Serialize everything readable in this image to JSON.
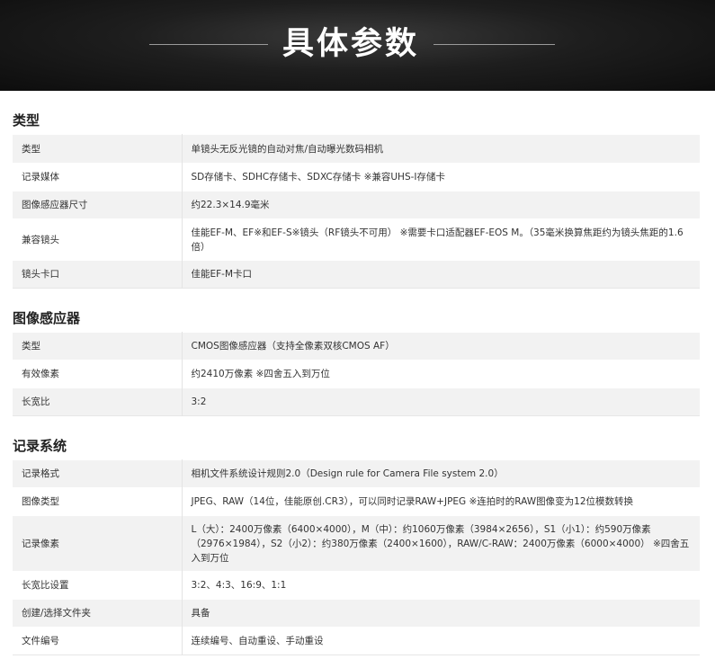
{
  "banner": {
    "title": "具体参数"
  },
  "sections": [
    {
      "title": "类型",
      "rows": [
        {
          "key": "类型",
          "value": "单镜头无反光镜的自动对焦/自动曝光数码相机"
        },
        {
          "key": "记录媒体",
          "value": "SD存储卡、SDHC存储卡、SDXC存储卡 ※兼容UHS-I存储卡"
        },
        {
          "key": "图像感应器尺寸",
          "value": "约22.3×14.9毫米"
        },
        {
          "key": "兼容镜头",
          "value": "佳能EF-M、EF※和EF-S※镜头（RF镜头不可用） ※需要卡口适配器EF-EOS M。（35毫米换算焦距约为镜头焦距的1.6倍）"
        },
        {
          "key": "镜头卡口",
          "value": "佳能EF-M卡口"
        }
      ]
    },
    {
      "title": "图像感应器",
      "rows": [
        {
          "key": "类型",
          "value": "CMOS图像感应器（支持全像素双核CMOS AF）"
        },
        {
          "key": "有效像素",
          "value": "约2410万像素 ※四舍五入到万位"
        },
        {
          "key": "长宽比",
          "value": "3:2"
        }
      ]
    },
    {
      "title": "记录系统",
      "rows": [
        {
          "key": "记录格式",
          "value": "相机文件系统设计规则2.0（Design rule for Camera File system 2.0）"
        },
        {
          "key": "图像类型",
          "value": "JPEG、RAW（14位，佳能原创.CR3），可以同时记录RAW+JPEG ※连拍时的RAW图像变为12位模数转换"
        },
        {
          "key": "记录像素",
          "value": "L（大）：2400万像素（6400×4000），M（中）：约1060万像素（3984×2656），S1（小1）：约590万像素（2976×1984），S2（小2）：约380万像素（2400×1600），RAW/C-RAW：2400万像素（6000×4000） ※四舍五入到万位"
        },
        {
          "key": "长宽比设置",
          "value": "3:2、4:3、16:9、1:1"
        },
        {
          "key": "创建/选择文件夹",
          "value": "具备"
        },
        {
          "key": "文件编号",
          "value": "连续编号、自动重设、手动重设"
        }
      ]
    }
  ]
}
